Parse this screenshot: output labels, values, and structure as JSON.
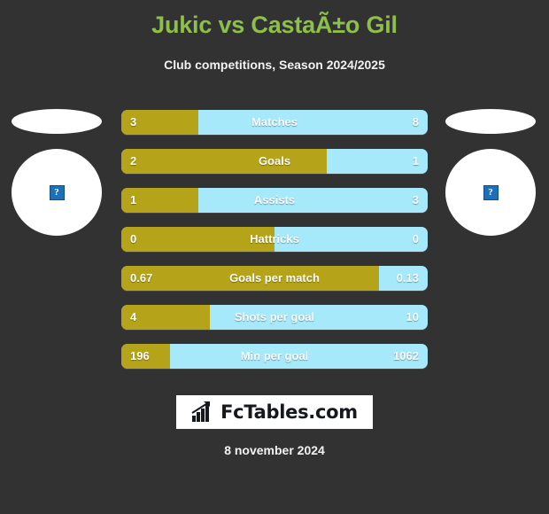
{
  "header": {
    "title": "Jukic vs CastaÃ±o Gil",
    "subtitle": "Club competitions, Season 2024/2025"
  },
  "players": {
    "left": {
      "flag_alt": "flag",
      "photo_alt": "?"
    },
    "right": {
      "flag_alt": "flag",
      "photo_alt": "?"
    }
  },
  "footer": {
    "logo_text": "FcTables.com",
    "logo_icon": "bar-chart-icon",
    "date": "8 november 2024"
  },
  "colors": {
    "background": "#333232",
    "title": "#8cc04a",
    "home_bar": "#b5a319",
    "away_bar": "#a5e9fb",
    "text": "#ffffff"
  },
  "chart_data": {
    "type": "bar",
    "title": "Jukic vs CastaÃ±o Gil",
    "subtitle": "Club competitions, Season 2024/2025",
    "orientation": "horizontal-diverging",
    "legend": [
      "Jukic",
      "CastaÃ±o Gil"
    ],
    "categories": [
      "Matches",
      "Goals",
      "Assists",
      "Hattricks",
      "Goals per match",
      "Shots per goal",
      "Min per goal"
    ],
    "series": [
      {
        "name": "Jukic",
        "color": "#b5a319",
        "values": [
          3,
          2,
          1,
          0,
          0.67,
          4,
          196
        ],
        "display": [
          "3",
          "2",
          "1",
          "0",
          "0.67",
          "4",
          "196"
        ],
        "share_pct": [
          25,
          67,
          25,
          50,
          84,
          29,
          16
        ]
      },
      {
        "name": "CastaÃ±o Gil",
        "color": "#a5e9fb",
        "values": [
          8,
          1,
          3,
          0,
          0.13,
          10,
          1062
        ],
        "display": [
          "8",
          "1",
          "3",
          "0",
          "0.13",
          "10",
          "1062"
        ],
        "share_pct": [
          75,
          33,
          75,
          50,
          16,
          71,
          84
        ]
      }
    ],
    "rows": [
      {
        "label": "Matches",
        "home": "3",
        "away": "8",
        "home_pct": 25
      },
      {
        "label": "Goals",
        "home": "2",
        "away": "1",
        "home_pct": 67
      },
      {
        "label": "Assists",
        "home": "1",
        "away": "3",
        "home_pct": 25
      },
      {
        "label": "Hattricks",
        "home": "0",
        "away": "0",
        "home_pct": 50
      },
      {
        "label": "Goals per match",
        "home": "0.67",
        "away": "0.13",
        "home_pct": 84
      },
      {
        "label": "Shots per goal",
        "home": "4",
        "away": "10",
        "home_pct": 29
      },
      {
        "label": "Min per goal",
        "home": "196",
        "away": "1062",
        "home_pct": 16
      }
    ],
    "grid": false,
    "xlabel": "",
    "ylabel": ""
  }
}
